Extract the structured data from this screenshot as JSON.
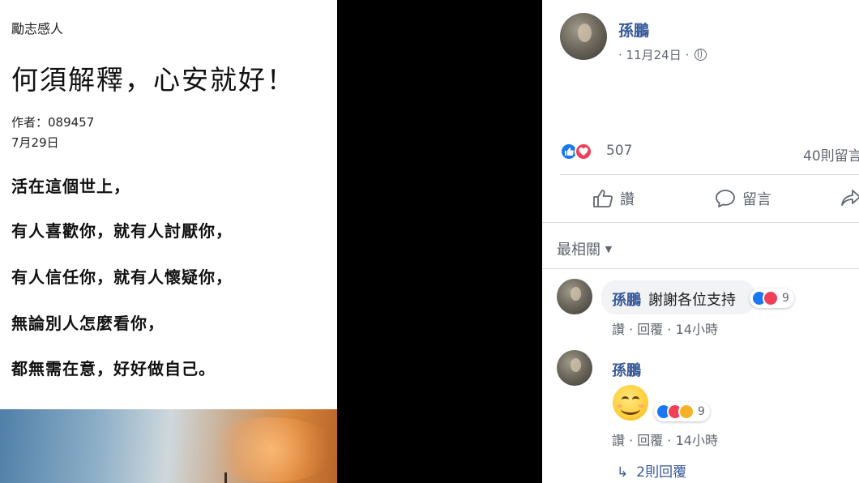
{
  "article": {
    "category": "勵志感人",
    "title": "何須解釋，心安就好！",
    "author": "作者：089457",
    "date": "7月29日",
    "lines": [
      "活在這個世上，",
      "有人喜歡你，就有人討厭你，",
      "有人信任你，就有人懷疑你，",
      "無論別人怎麼看你，",
      "都無需在意，好好做自己。"
    ]
  },
  "post": {
    "author": "孫鵬",
    "meta": "· 11月24日 ·",
    "privacy_icon": "globe-icon",
    "reaction_count": "507",
    "comment_count": "40則留言",
    "actions": {
      "like": "讚",
      "comment": "留言"
    },
    "sort_label": "最相關"
  },
  "comments": [
    {
      "author": "孫鵬",
      "text": "謝謝各位支持",
      "reactions": "9",
      "like": "讚",
      "dot": "·",
      "reply": "回覆",
      "time": "14小時"
    },
    {
      "author": "孫鵬",
      "emoji": "smiling-face",
      "reactions": "9",
      "like": "讚",
      "dot": "·",
      "reply": "回覆",
      "time": "14小時",
      "replies": "2則回覆"
    }
  ],
  "colors": {
    "link": "#365899",
    "like": "#1877f2",
    "love": "#f33e58",
    "haha": "#f7b125",
    "meta": "#616770"
  }
}
